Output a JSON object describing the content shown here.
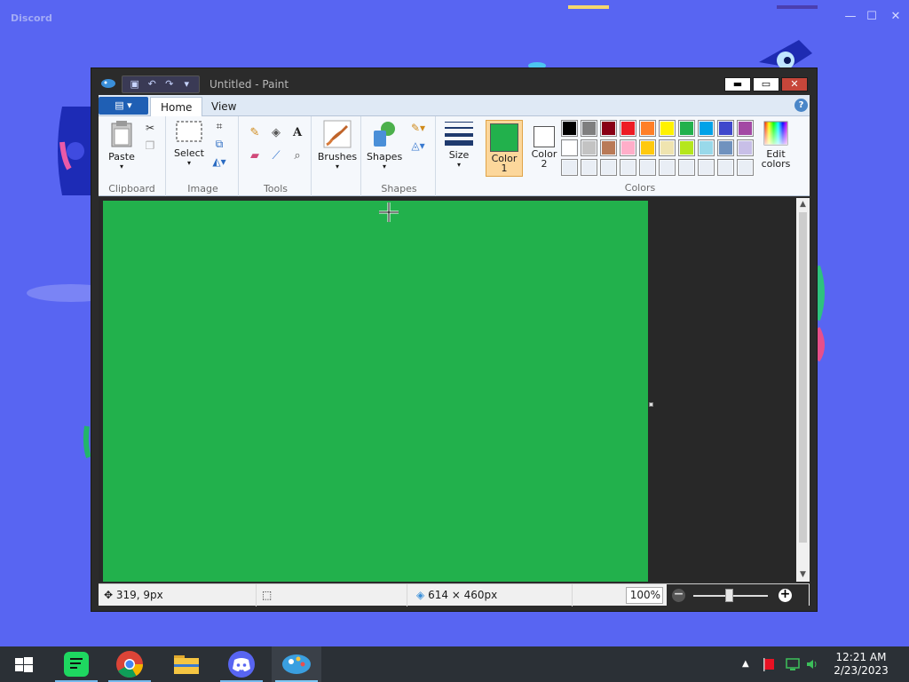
{
  "discord": {
    "app_name": "Discord",
    "minimize": "—",
    "maximize": "☐",
    "close": "✕"
  },
  "paint": {
    "title": "Untitled - Paint",
    "quick_access": [
      "save",
      "undo",
      "redo",
      "customize"
    ],
    "window_controls": {
      "minimize": "▬",
      "maximize": "▭",
      "close": "✕"
    },
    "tabs": {
      "file": "▤ ▾",
      "home": "Home",
      "view": "View"
    },
    "help": "?",
    "groups": {
      "clipboard": {
        "label": "Clipboard",
        "paste": "Paste"
      },
      "image": {
        "label": "Image",
        "select": "Select"
      },
      "tools": {
        "label": "Tools"
      },
      "brushes": {
        "label": "Brushes"
      },
      "shapes": {
        "label": "Shapes",
        "shapes_btn": "Shapes"
      },
      "size": {
        "label": "Size"
      },
      "colors": {
        "label": "Colors",
        "color1": "Color 1",
        "color1_line1": "Color",
        "color1_line2": "1",
        "color2_line1": "Color",
        "color2_line2": "2",
        "edit": "Edit colors",
        "edit_line1": "Edit",
        "edit_line2": "colors",
        "selected_color1": "#22b14c",
        "selected_color2": "#ffffff",
        "palette_row1": [
          "#000000",
          "#7f7f7f",
          "#880015",
          "#ed1c24",
          "#ff7f27",
          "#fff200",
          "#22b14c",
          "#00a2e8",
          "#3f48cc",
          "#a349a4"
        ],
        "palette_row2": [
          "#ffffff",
          "#c3c3c3",
          "#b97a57",
          "#ffaec9",
          "#ffc90e",
          "#efe4b0",
          "#b5e61d",
          "#99d9ea",
          "#7092be",
          "#c8bfe7"
        ]
      }
    },
    "canvas_color": "#22b14c",
    "status": {
      "cursor_pos": "319, 9px",
      "selection_size": "",
      "image_size": "614 × 460px",
      "zoom": "100%"
    }
  },
  "taskbar": {
    "apps": [
      "start",
      "spotify",
      "chrome",
      "file-explorer",
      "discord",
      "paint"
    ],
    "tray_expand": "▲",
    "time": "12:21 AM",
    "date": "2/23/2023"
  }
}
